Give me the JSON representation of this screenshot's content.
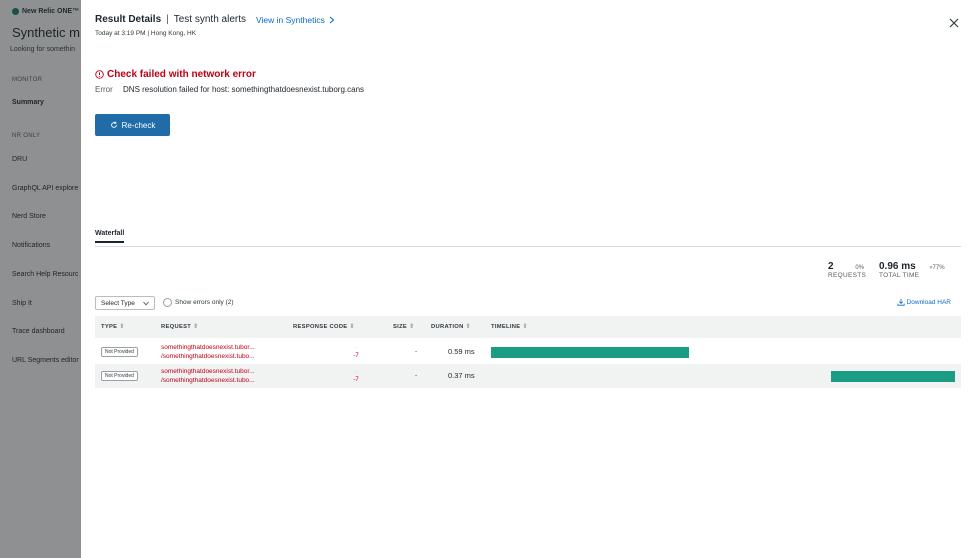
{
  "background": {
    "logo": "New Relic ONE™",
    "title": "Synthetic m",
    "subtitle": "Looking for somethin",
    "sections": [
      {
        "label": "MONITOR",
        "items": [
          {
            "label": "Summary",
            "active": true
          }
        ]
      },
      {
        "label": "NR ONLY",
        "items": [
          {
            "label": "DRU"
          },
          {
            "label": "GraphQL API explore"
          },
          {
            "label": "Nerd Store"
          },
          {
            "label": "Notifications"
          },
          {
            "label": "Search Help Resourc"
          },
          {
            "label": "Ship It"
          },
          {
            "label": "Trace dashboard"
          },
          {
            "label": "URL Segments editor"
          }
        ]
      }
    ]
  },
  "panel": {
    "title": "Result Details",
    "separator": "|",
    "monitor_name": "Test synth alerts",
    "link_label": "View in Synthetics",
    "timestamp": "Today at 3:19 PM",
    "location_sep": "|",
    "location": "Hong Kong, HK",
    "close_icon": "close-icon"
  },
  "error": {
    "title": "Check failed with network error",
    "label": "Error",
    "message": "DNS resolution failed for host: somethingthatdoesnexist.tuborg.cans"
  },
  "recheck_label": "Re-check",
  "tabs": [
    {
      "label": "Waterfall",
      "active": true
    }
  ],
  "stats": {
    "requests_value": "2",
    "requests_label": "REQUESTS",
    "requests_pct": "0%",
    "time_value": "0.96 ms",
    "time_label": "TOTAL TIME",
    "time_pct": "▿77%"
  },
  "filters": {
    "select_type": "Select Type",
    "show_errors": "Show errors only (2)",
    "download": "Download HAR"
  },
  "table": {
    "columns": {
      "type": "TYPE",
      "request": "REQUEST",
      "response_code": "RESPONSE CODE",
      "size": "SIZE",
      "duration": "DURATION",
      "timeline": "TIMELINE"
    },
    "rows": [
      {
        "type": "Not Provided",
        "request_host": "somethingthatdoesnexist.tubor...",
        "request_path": "/somethingthatdoesnexist.tubo...",
        "code_sub": "-",
        "code": "-7",
        "size": "-",
        "duration": "0.59 ms",
        "timeline_start": 0.0,
        "timeline_end": 0.427
      },
      {
        "type": "Not Provided",
        "request_host": "somethingthatdoesnexist.tubor...",
        "request_path": "/somethingthatdoesnexist.tubo...",
        "code_sub": "-",
        "code": "-7",
        "size": "-",
        "duration": "0.37 ms",
        "timeline_start": 0.732,
        "timeline_end": 1.0
      }
    ]
  },
  "colors": {
    "error": "#bf0016",
    "accent": "#1f6ca8",
    "link": "#0b6acb",
    "timeline": "#1a9c85"
  }
}
